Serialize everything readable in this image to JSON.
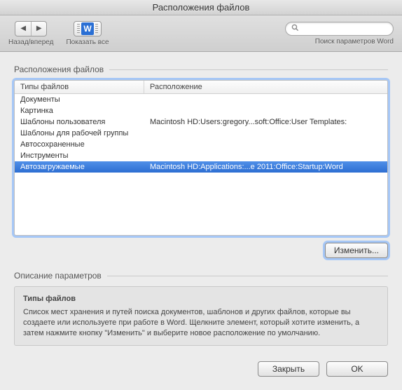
{
  "window": {
    "title": "Расположения файлов"
  },
  "toolbar": {
    "back_forward_label": "Назад/вперед",
    "show_all_label": "Показать все",
    "search_label": "Поиск параметров Word",
    "search_placeholder": ""
  },
  "group": {
    "label": "Расположения файлов",
    "columns": {
      "type": "Типы файлов",
      "location": "Расположение"
    },
    "rows": [
      {
        "type": "Документы",
        "location": ""
      },
      {
        "type": "Картинка",
        "location": ""
      },
      {
        "type": "Шаблоны пользователя",
        "location": "Macintosh HD:Users:gregory...soft:Office:User Templates:"
      },
      {
        "type": "Шаблоны для рабочей группы",
        "location": ""
      },
      {
        "type": "Автосохраненные",
        "location": ""
      },
      {
        "type": "Инструменты",
        "location": ""
      },
      {
        "type": "Автозагружаемые",
        "location": "Macintosh HD:Applications:...e 2011:Office:Startup:Word",
        "selected": true
      }
    ],
    "modify_label": "Изменить..."
  },
  "description": {
    "group_label": "Описание параметров",
    "title": "Типы файлов",
    "body": "Список мест хранения и путей поиска документов, шаблонов и других файлов, которые вы создаете или используете при работе в Word. Щелкните элемент, который хотите изменить, а затем нажмите кнопку \"Изменить\" и выберите новое расположение по умолчанию."
  },
  "footer": {
    "close": "Закрыть",
    "ok": "OK"
  }
}
